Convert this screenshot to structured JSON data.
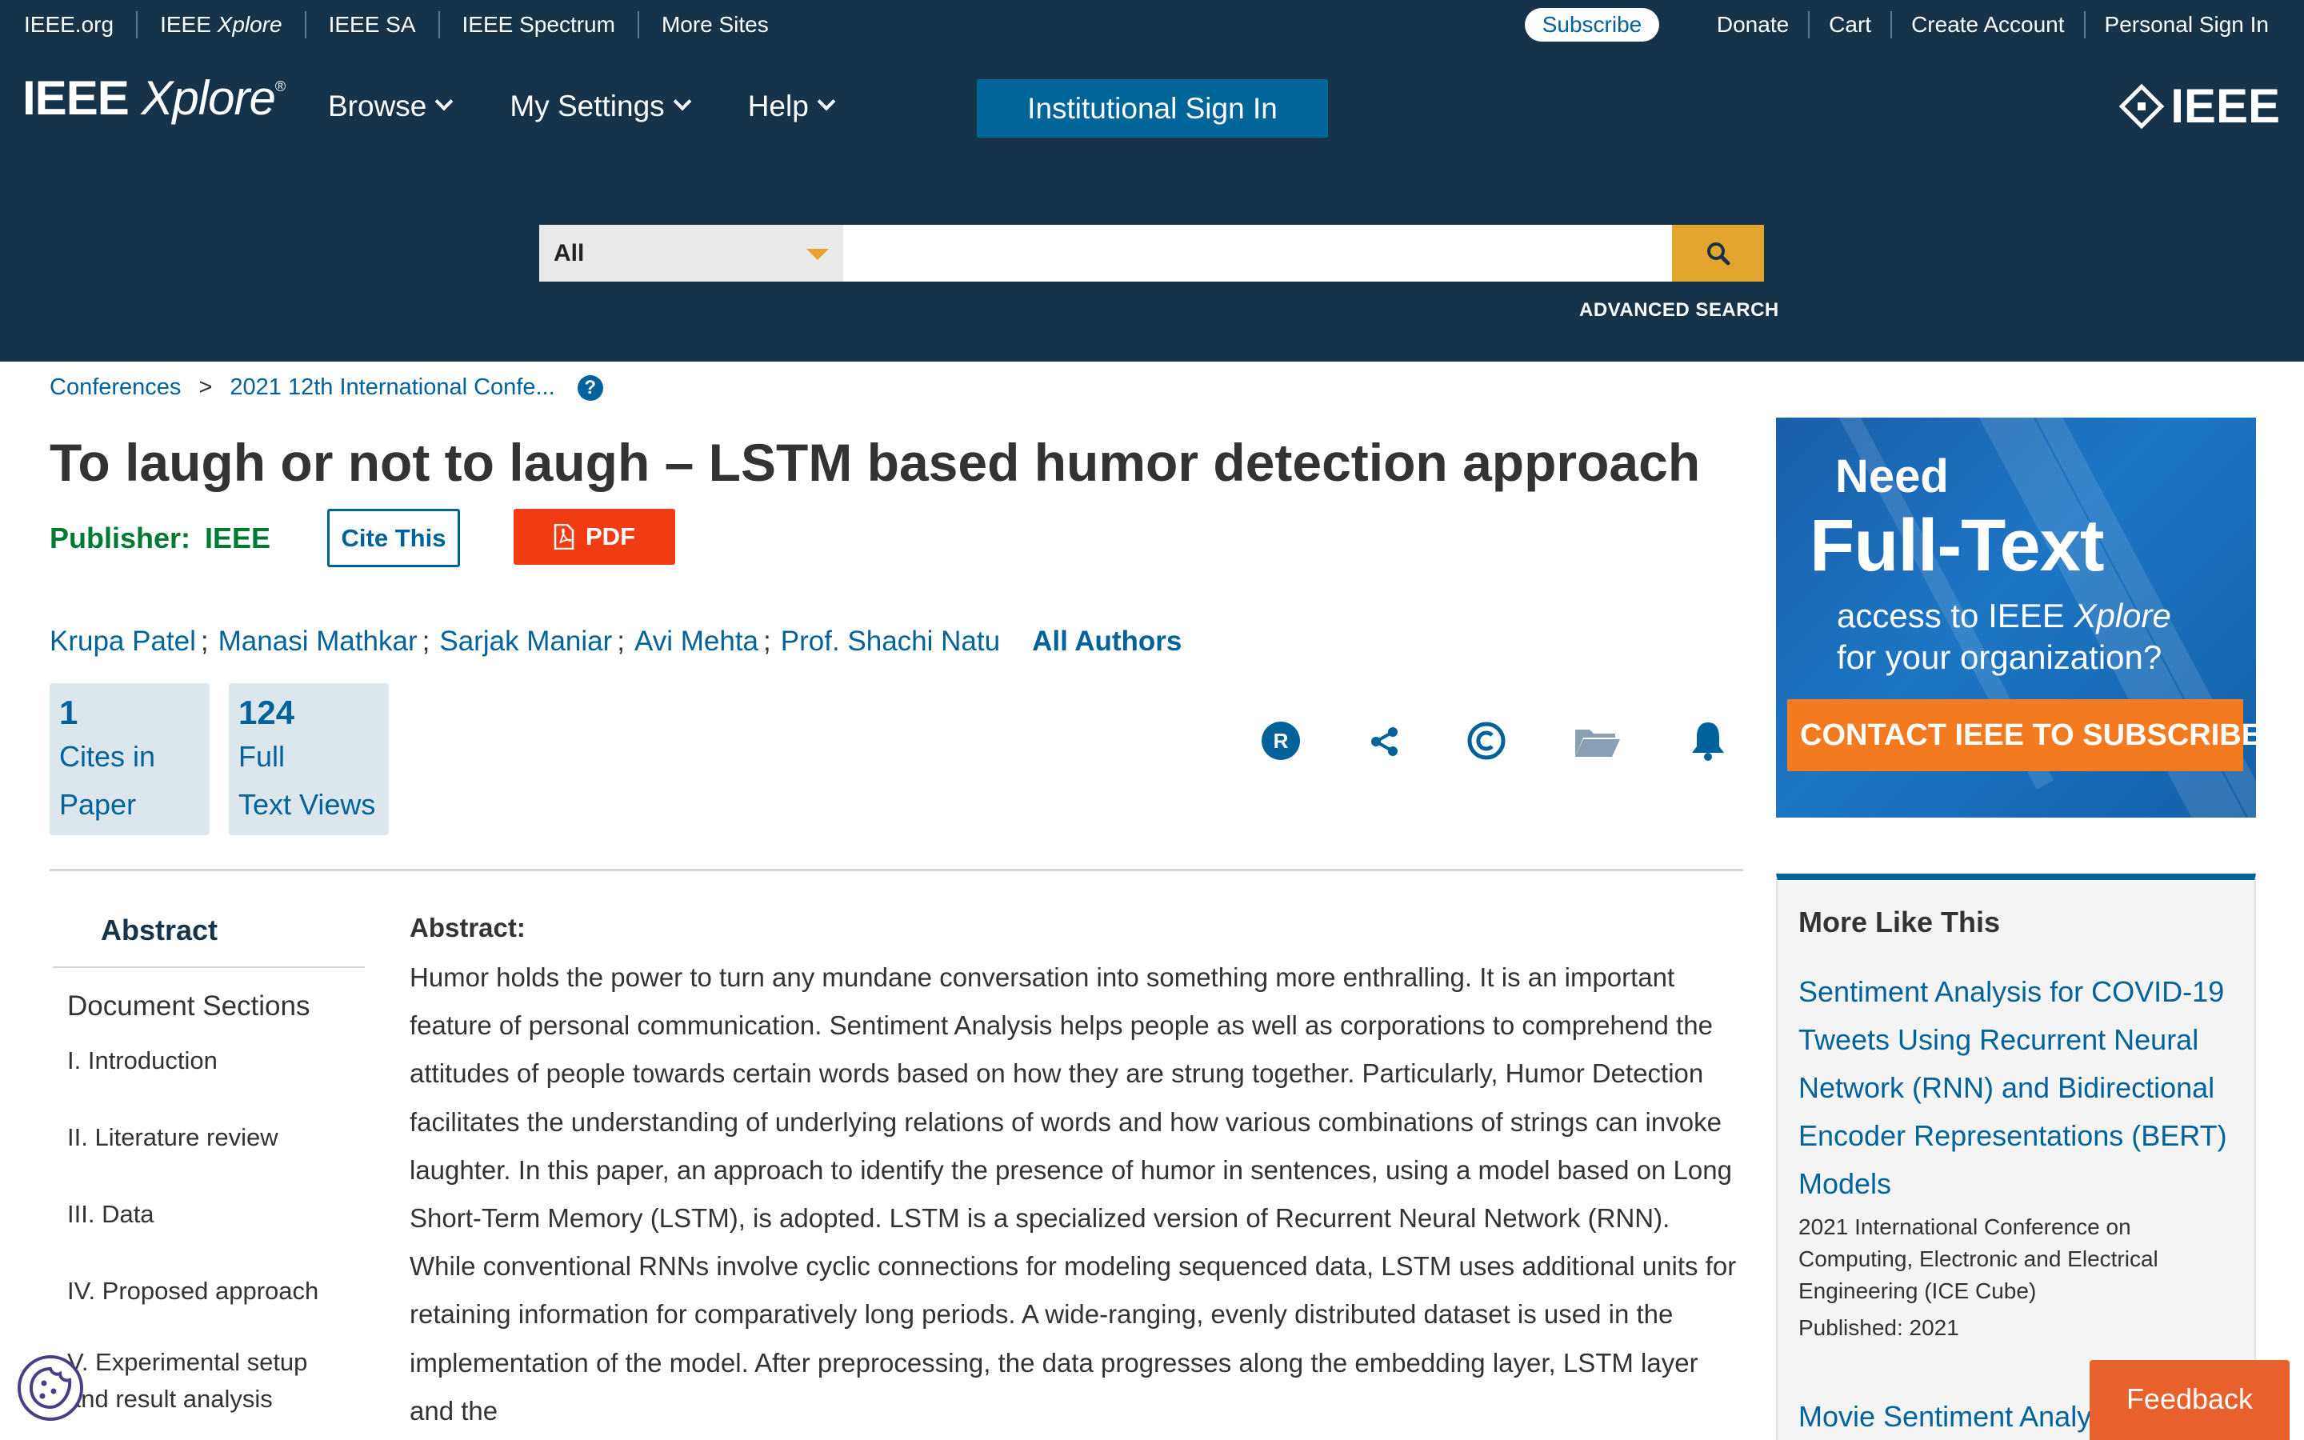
{
  "utility_bar": {
    "links_left": [
      "IEEE.org",
      "IEEE",
      "Xplore",
      "IEEE SA",
      "IEEE Spectrum",
      "More Sites"
    ],
    "subscribe": "Subscribe",
    "links_right": [
      "Donate",
      "Cart",
      "Create Account",
      "Personal Sign In"
    ]
  },
  "header": {
    "logo_main": "IEEE",
    "logo_italic": "Xplore",
    "logo_reg": "®",
    "nav": [
      "Browse",
      "My Settings",
      "Help"
    ],
    "institutional_sign_in": "Institutional Sign In",
    "ieee_logo_text": "IEEE"
  },
  "search": {
    "scope": "All",
    "query": "",
    "advanced": "ADVANCED SEARCH"
  },
  "breadcrumb": {
    "items": [
      "Conferences",
      "2021 12th International Confe..."
    ],
    "separator": ">",
    "help": "?"
  },
  "document": {
    "title": "To laugh or not to laugh – LSTM based humor detection approach",
    "publisher_label": "Publisher:",
    "publisher": "IEEE",
    "cite_label": "Cite This",
    "pdf_label": "PDF",
    "authors": [
      "Krupa Patel",
      "Manasi Mathkar",
      "Sarjak Maniar",
      "Avi Mehta",
      "Prof. Shachi Natu"
    ],
    "author_separator": ";",
    "all_authors": "All Authors",
    "metrics": [
      {
        "value": "1",
        "label_1": "Cites in",
        "label_2": "Paper"
      },
      {
        "value": "124",
        "label_1": "Full",
        "label_2": "Text Views"
      }
    ],
    "action_icons": [
      "rights-icon",
      "share-icon",
      "copyright-icon",
      "folder-icon",
      "bell-icon"
    ]
  },
  "doc_nav": {
    "abstract_tab": "Abstract",
    "sections_heading": "Document Sections",
    "sections": [
      "I.  Introduction",
      "II.  Literature review",
      "III.  Data",
      "IV.  Proposed approach",
      "V.  Experimental setup",
      "and result analysis"
    ]
  },
  "abstract": {
    "label": "Abstract:",
    "text": "Humor holds the power to turn any mundane conversation into something more enthralling. It is an important feature of personal communication. Sentiment Analysis helps people as well as corporations to comprehend the attitudes of people towards certain words based on how they are strung together. Particularly, Humor Detection facilitates the understanding of underlying relations of words and how various combinations of strings can invoke laughter. In this paper, an approach to identify the presence of humor in sentences, using a model based on Long Short-Term Memory (LSTM), is adopted. LSTM is a specialized version of Recurrent Neural Network (RNN). While conventional RNNs involve cyclic connections for modeling sequenced data, LSTM uses additional units for retaining information for comparatively long periods. A wide-ranging, evenly distributed dataset is used in the implementation of the model. After preprocessing, the data progresses along the embedding layer, LSTM layer and the"
  },
  "ad": {
    "need": "Need",
    "full_text": "Full-Text",
    "access_line_1_pre": "access to IEEE ",
    "access_line_1_italic": "Xplore",
    "access_line_2": "for your organization?",
    "contact": "CONTACT IEEE TO SUBSCRIBE ›"
  },
  "more_like_this": {
    "heading": "More Like This",
    "item_1_title": "Sentiment Analysis for COVID-19 Tweets Using Recurrent Neural Network (RNN) and Bidirectional Encoder Representations (BERT) Models",
    "item_1_venue": "2021 International Conference on Computing, Electronic and Electrical Engineering (ICE Cube)",
    "item_1_published": "Published: 2021",
    "item_2_title": "Movie Sentiment Analy"
  },
  "feedback": "Feedback",
  "colors": {
    "header_bg": "#16334a",
    "link_blue": "#00629b",
    "publisher_green": "#007a33",
    "pdf_red": "#f13b12",
    "search_gold": "#e3a42e",
    "feedback_orange": "#e8602b"
  }
}
